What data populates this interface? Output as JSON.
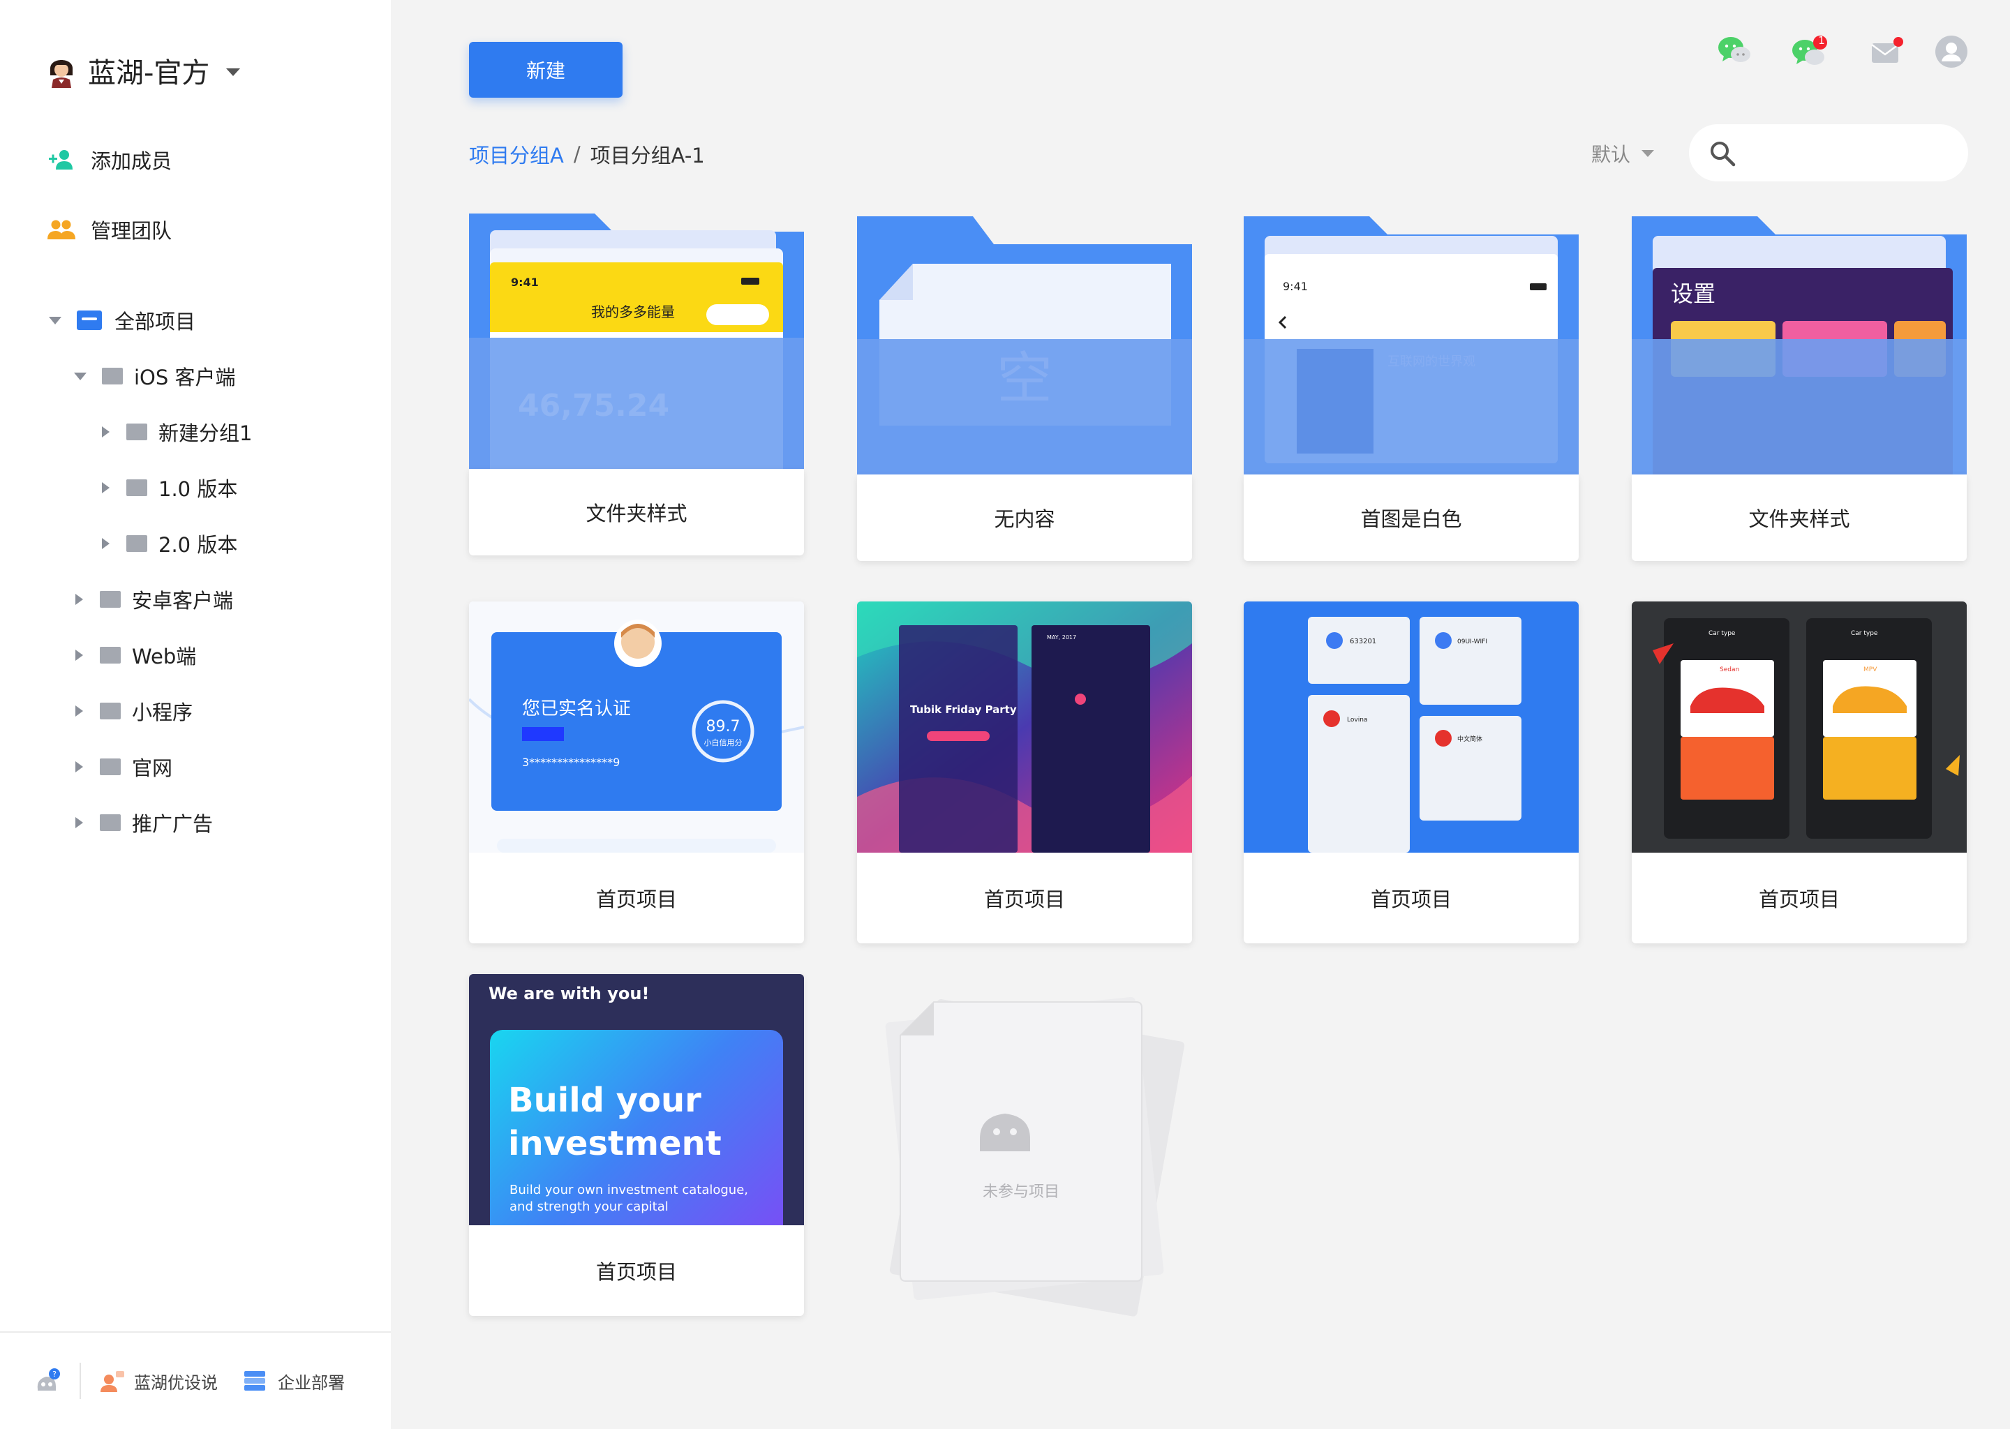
{
  "sidebar": {
    "team_name": "蓝湖-官方",
    "actions": [
      {
        "label": "添加成员"
      },
      {
        "label": "管理团队"
      }
    ],
    "tree": {
      "root": "全部项目",
      "items": [
        {
          "label": "iOS 客户端"
        },
        {
          "label": "新建分组1"
        },
        {
          "label": "1.0 版本"
        },
        {
          "label": "2.0 版本"
        },
        {
          "label": "安卓客户端"
        },
        {
          "label": "Web端"
        },
        {
          "label": "小程序"
        },
        {
          "label": "官网"
        },
        {
          "label": "推广广告"
        }
      ]
    },
    "footer": [
      {
        "label": "蓝湖优设说"
      },
      {
        "label": "企业部署"
      }
    ]
  },
  "toolbar": {
    "new_label": "新建",
    "notification_count": "1",
    "sort_label": "默认",
    "search_value": ""
  },
  "breadcrumb": {
    "parent": "项目分组A",
    "separator": "/",
    "current": "项目分组A-1"
  },
  "cards": [
    {
      "label": "文件夹样式",
      "thumb_title": "我的多多能量",
      "thumb_time": "9:41",
      "thumb_number": "46,75.24"
    },
    {
      "label": "无内容",
      "thumb_text": "空"
    },
    {
      "label": "首图是白色",
      "thumb_time": "9:41",
      "thumb_text": "互联网的世界观"
    },
    {
      "label": "文件夹样式",
      "thumb_title": "设置"
    },
    {
      "label": "首页项目",
      "thumb_title": "您已实名认证",
      "thumb_score": "89.7",
      "thumb_score_label": "小白信用分",
      "thumb_id": "3***************9"
    },
    {
      "label": "首页项目",
      "thumb_title": "Tubik Friday Party",
      "thumb_month": "MAY, 2017"
    },
    {
      "label": "首页项目",
      "thumb_a": "633201",
      "thumb_b": "09UI-WIFI",
      "thumb_c": "Lovina",
      "thumb_d": "中文简体"
    },
    {
      "label": "首页项目",
      "thumb_a": "Sedan",
      "thumb_b": "MPV",
      "thumb_title": "Car type"
    },
    {
      "label": "首页项目",
      "thumb_header": "We are with you!",
      "thumb_title": "Build your investment",
      "thumb_sub": "Build your own investment catalogue, and strength your capital"
    },
    {
      "label": "未参与项目"
    }
  ],
  "colors": {
    "accent": "#2f7bf0",
    "badge": "#f5222d",
    "wechat": "#4cd168"
  }
}
